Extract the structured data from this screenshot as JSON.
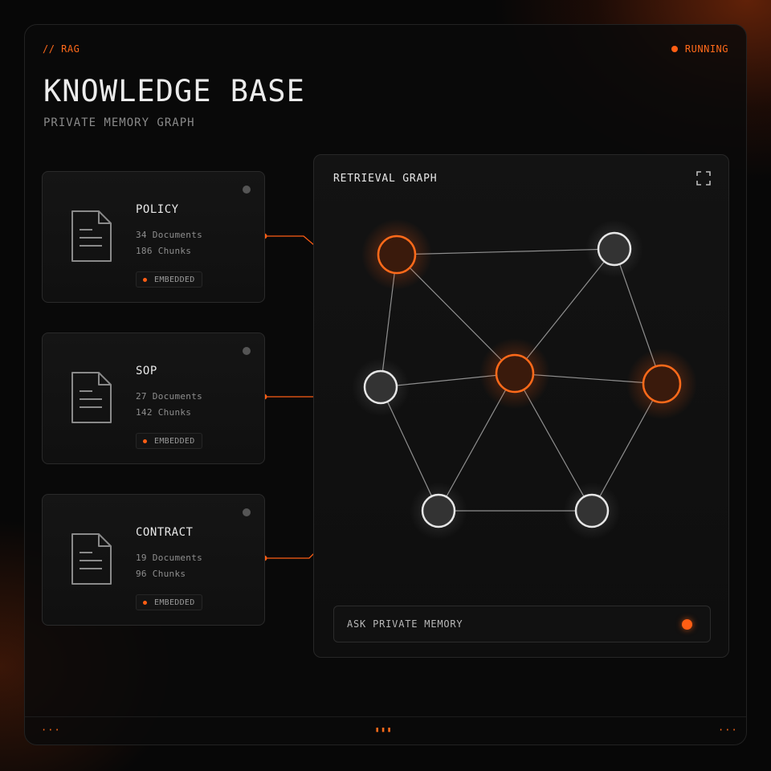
{
  "header": {
    "tag": "// RAG",
    "status": "RUNNING",
    "title": "KNOWLEDGE BASE",
    "subtitle": "PRIVATE MEMORY GRAPH"
  },
  "sources": [
    {
      "name": "POLICY",
      "documents": "34 Documents",
      "chunks": "186 Chunks",
      "badge": "EMBEDDED"
    },
    {
      "name": "SOP",
      "documents": "27 Documents",
      "chunks": "142 Chunks",
      "badge": "EMBEDDED"
    },
    {
      "name": "CONTRACT",
      "documents": "19 Documents",
      "chunks": "96 Chunks",
      "badge": "EMBEDDED"
    }
  ],
  "graph_panel": {
    "title": "RETRIEVAL GRAPH",
    "ask_label": "ASK PRIVATE MEMORY"
  },
  "footer": {
    "left": "···",
    "center": "▮▮▮",
    "right": "···"
  },
  "colors": {
    "accent": "#ff5e14",
    "node_active": "#ff6a1a",
    "node_idle": "#e0e0e0",
    "background": "#070707"
  },
  "icons": {
    "expand": "expand-icon",
    "document": "document-icon",
    "status": "status-dot-icon"
  }
}
